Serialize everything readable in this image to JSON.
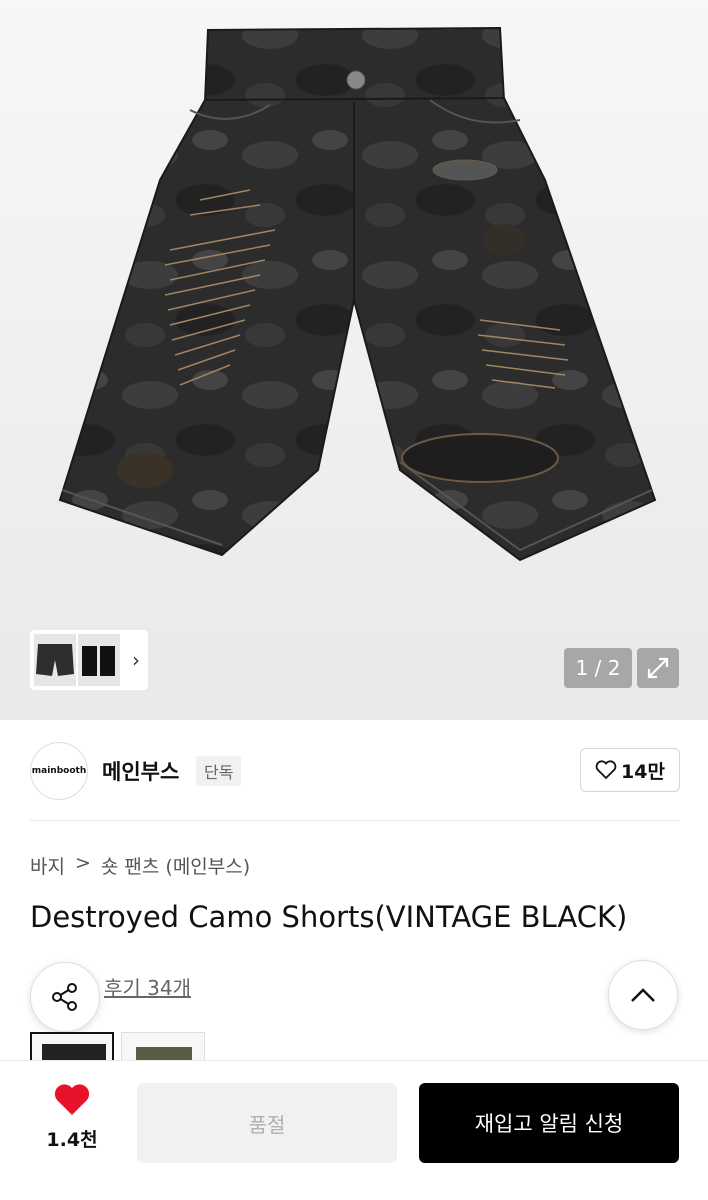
{
  "gallery": {
    "counter": "1 / 2",
    "thumbnails": [
      "product-front-thumb",
      "product-back-thumb"
    ]
  },
  "brand": {
    "logo_text": "mainbooth",
    "name": "메인부스",
    "badge": "단독",
    "like_count": "14만"
  },
  "breadcrumb": {
    "category": "바지",
    "separator": ">",
    "subcategory": "숏 팬츠 (메인부스)"
  },
  "product": {
    "title": "Destroyed Camo Shorts(VINTAGE BLACK)",
    "review_link": "후기 34개"
  },
  "bottom_bar": {
    "wish_count": "1.4천",
    "soldout_label": "품절",
    "restock_label": "재입고 알림 신청"
  },
  "colors": {
    "heart": "#e8132b",
    "primary_button": "#000000",
    "disabled_button": "#f1f1f1"
  },
  "icons": [
    "chevron-right-icon",
    "expand-icon",
    "heart-outline-icon",
    "share-icon",
    "chevron-up-icon",
    "heart-filled-icon"
  ]
}
